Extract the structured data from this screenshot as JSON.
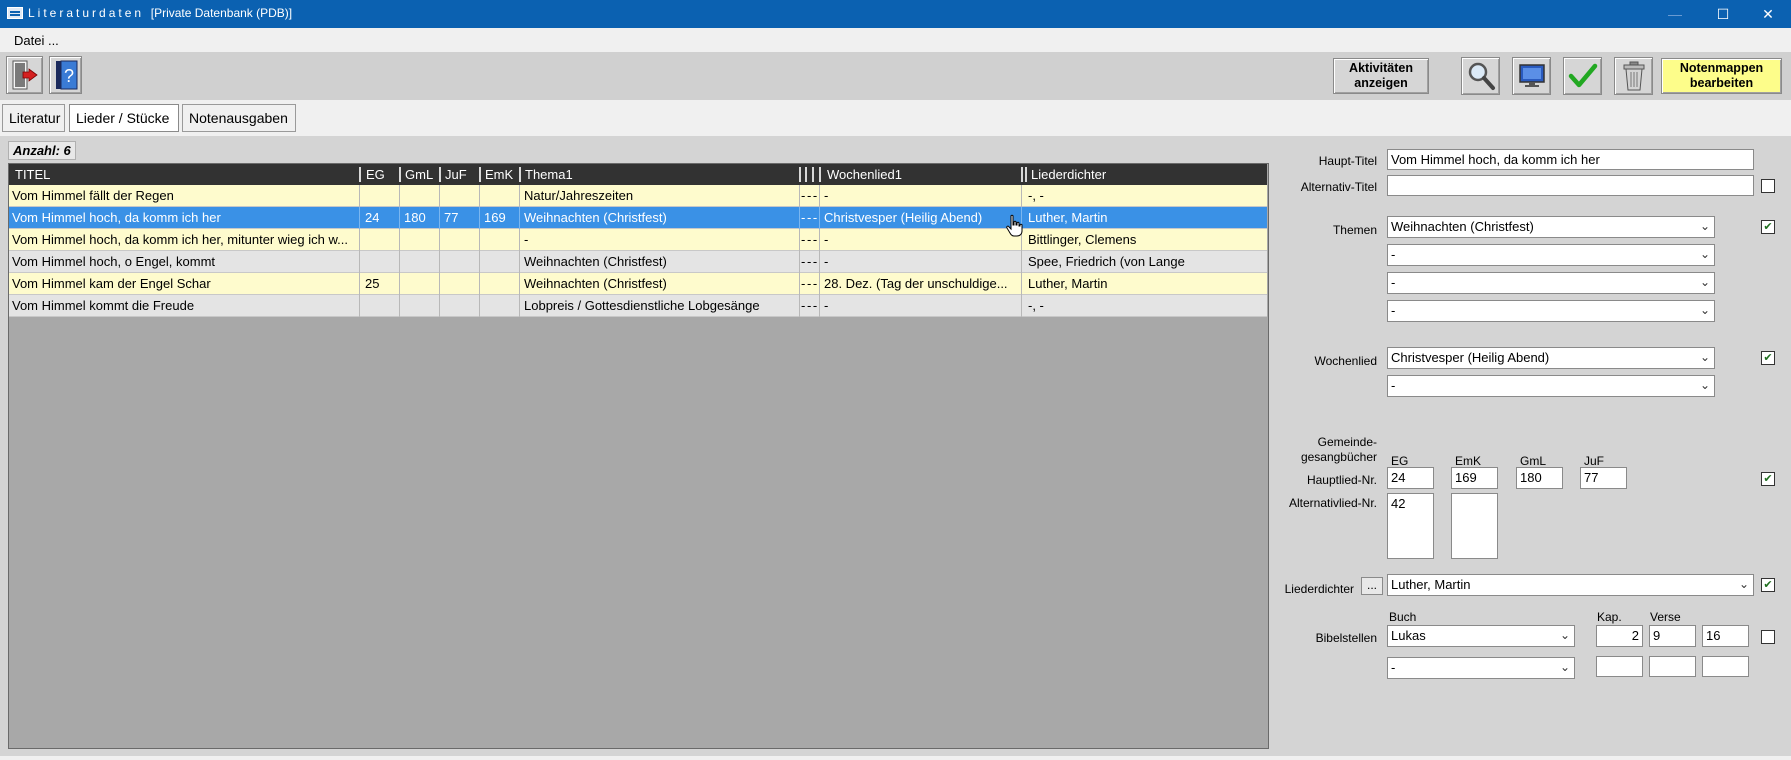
{
  "window": {
    "title_spaced": "Literaturdaten",
    "title_rest": "[Private Datenbank (PDB)]",
    "minimize": "—",
    "maximize": "☐",
    "close": "✕"
  },
  "menu": {
    "datei": "Datei ..."
  },
  "toolbar": {
    "activities_label_1": "Aktivitäten",
    "activities_label_2": "anzeigen",
    "notenmappen_label_1": "Notenmappen",
    "notenmappen_label_2": "bearbeiten",
    "help_glyph": "?",
    "check_glyph": "✔"
  },
  "tabs": [
    "Literatur",
    "Lieder / Stücke",
    "Notenausgaben"
  ],
  "count_label": "Anzahl: 6",
  "grid": {
    "columns": [
      "TITEL",
      "EG",
      "GmL",
      "JuF",
      "EmK",
      "Thema1",
      "Wochenlied1",
      "Liederdichter"
    ],
    "rows": [
      {
        "title": "Vom Himmel fällt der Regen",
        "eg": "",
        "gml": "",
        "juf": "",
        "emk": "",
        "thema": "Natur/Jahreszeiten",
        "dash": "- - -",
        "wochenlied": "-",
        "dichter": "-, -"
      },
      {
        "title": "Vom Himmel hoch, da komm ich her",
        "eg": "24",
        "gml": "180",
        "juf": "77",
        "emk": "169",
        "thema": "Weihnachten (Christfest)",
        "dash": "- - -",
        "wochenlied": "Christvesper (Heilig Abend)",
        "dichter": "Luther, Martin"
      },
      {
        "title": "Vom Himmel hoch, da komm ich her, mitunter wieg ich w...",
        "eg": "",
        "gml": "",
        "juf": "",
        "emk": "",
        "thema": "-",
        "dash": "- - -",
        "wochenlied": "-",
        "dichter": "Bittlinger, Clemens"
      },
      {
        "title": "Vom Himmel hoch, o Engel, kommt",
        "eg": "",
        "gml": "",
        "juf": "",
        "emk": "",
        "thema": "Weihnachten (Christfest)",
        "dash": "- - -",
        "wochenlied": "-",
        "dichter": "Spee, Friedrich (von Lange"
      },
      {
        "title": "Vom Himmel kam der Engel Schar",
        "eg": "25",
        "gml": "",
        "juf": "",
        "emk": "",
        "thema": "Weihnachten (Christfest)",
        "dash": "- - -",
        "wochenlied": "28. Dez. (Tag der unschuldige...",
        "dichter": "Luther, Martin"
      },
      {
        "title": "Vom Himmel kommt die Freude",
        "eg": "",
        "gml": "",
        "juf": "",
        "emk": "",
        "thema": "Lobpreis / Gottesdienstliche Lobgesänge",
        "dash": "- - -",
        "wochenlied": "-",
        "dichter": "-, -"
      }
    ]
  },
  "form": {
    "haupt_titel_label": "Haupt-Titel",
    "haupt_titel": "Vom Himmel hoch, da komm ich her",
    "alternativ_titel_label": "Alternativ-Titel",
    "alternativ_titel": "",
    "themen_label": "Themen",
    "themen": [
      "Weihnachten (Christfest)",
      "-",
      "-",
      "-"
    ],
    "wochenlied_label": "Wochenlied",
    "wochenlied": [
      "Christvesper (Heilig Abend)",
      "-"
    ],
    "gemeinde_label_1": "Gemeinde-",
    "gemeinde_label_2": "gesangbücher",
    "col_eg": "EG",
    "col_emk": "EmK",
    "col_gml": "GmL",
    "col_juf": "JuF",
    "hauptlied_label": "Hauptlied-Nr.",
    "hauptlied_eg": "24",
    "hauptlied_emk": "169",
    "hauptlied_gml": "180",
    "hauptlied_juf": "77",
    "alternativlied_label": "Alternativlied-Nr.",
    "alternativlied_eg": "42",
    "alternativlied_emk": "",
    "liederdichter_label": "Liederdichter",
    "liederdichter_dots": "...",
    "liederdichter": "Luther, Martin",
    "buch_label": "Buch",
    "kap_label": "Kap.",
    "verse_label": "Verse",
    "bibelstellen_label": "Bibelstellen",
    "bibel_buch_1": "Lukas",
    "bibel_kap_1": "2",
    "bibel_vers_von_1": "9",
    "bibel_vers_bis_1": "16",
    "bibel_buch_2": "-",
    "bibel_kap_2": "",
    "bibel_vers_von_2": "",
    "bibel_vers_bis_2": ""
  },
  "colors": {
    "titlebar": "#0b61b1",
    "grid_header": "#323232",
    "row_yellow": "#fefbcd",
    "row_grey": "#e4e4e4",
    "row_selected": "#3a91e6",
    "notenmappen_button": "#fdfd8a",
    "check_green": "#1f6f1f"
  },
  "icons": [
    "app-icon",
    "exit-door-icon",
    "help-book-icon",
    "magnifier-icon",
    "monitor-icon",
    "checkmark-icon",
    "trash-can-icon",
    "hand-cursor-icon",
    "dropdown-arrow-icon"
  ]
}
